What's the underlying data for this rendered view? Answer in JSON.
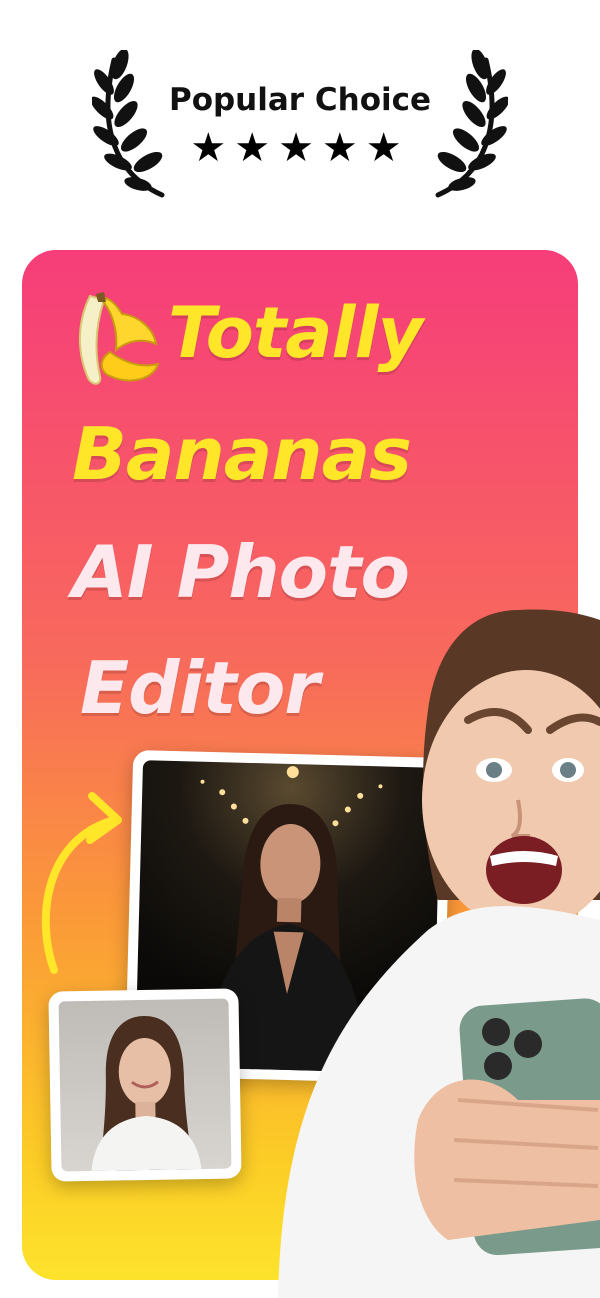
{
  "badge": {
    "title": "Popular Choice",
    "stars": "★★★★★",
    "rating": 5
  },
  "headline": {
    "line1": "Totally",
    "line2": "Bananas",
    "line3": "AI Photo",
    "line4": "Editor"
  },
  "colors": {
    "accent_yellow": "#ffe628",
    "gradient_top": "#f63d7a",
    "gradient_bottom": "#fde32c"
  },
  "icons": [
    "laurel-left-icon",
    "laurel-right-icon",
    "star-icon",
    "banana-icon",
    "curved-arrow-icon"
  ]
}
